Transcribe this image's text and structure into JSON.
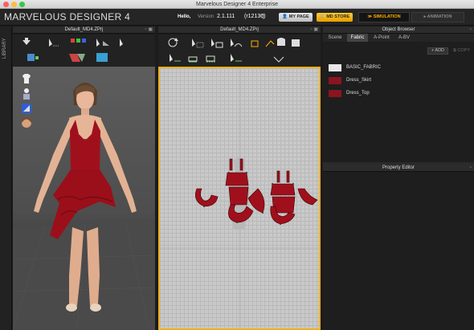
{
  "window": {
    "title": "Marvelous Designer 4 Enterprise"
  },
  "topbar": {
    "logo": "MARVELOUS DESIGNER 4",
    "hello": "Hello,",
    "version_label": "Version",
    "version_value": "2.1.111",
    "build": "(r12130)",
    "mypage_label": "MY PAGE",
    "mdstore_label": "MD STORE",
    "simulation_label": "SIMULATION",
    "animation_label": "ANIMATION"
  },
  "library": {
    "label": "LIBRARY"
  },
  "panel3d": {
    "title": "Default_MD4.ZPrj"
  },
  "panel2d": {
    "title": "Default_MD4.ZPrj"
  },
  "object_browser": {
    "title": "Object Browser",
    "tabs": [
      "Scene",
      "Fabric",
      "A-Point",
      "A-BV"
    ],
    "active_tab": "Fabric",
    "add_label": "ADD",
    "copy_label": "COPY",
    "fabrics": [
      {
        "name": "BASIC_FABRIC",
        "color": "#e8e8e8"
      },
      {
        "name": "Dress_Skirt",
        "color": "#8b1420"
      },
      {
        "name": "Dress_Top",
        "color": "#8b1420"
      }
    ]
  },
  "property_editor": {
    "title": "Property Editor"
  },
  "colors": {
    "accent": "#ffb000",
    "fabric_red": "#a0101c",
    "selection_border": "#f0b020"
  }
}
